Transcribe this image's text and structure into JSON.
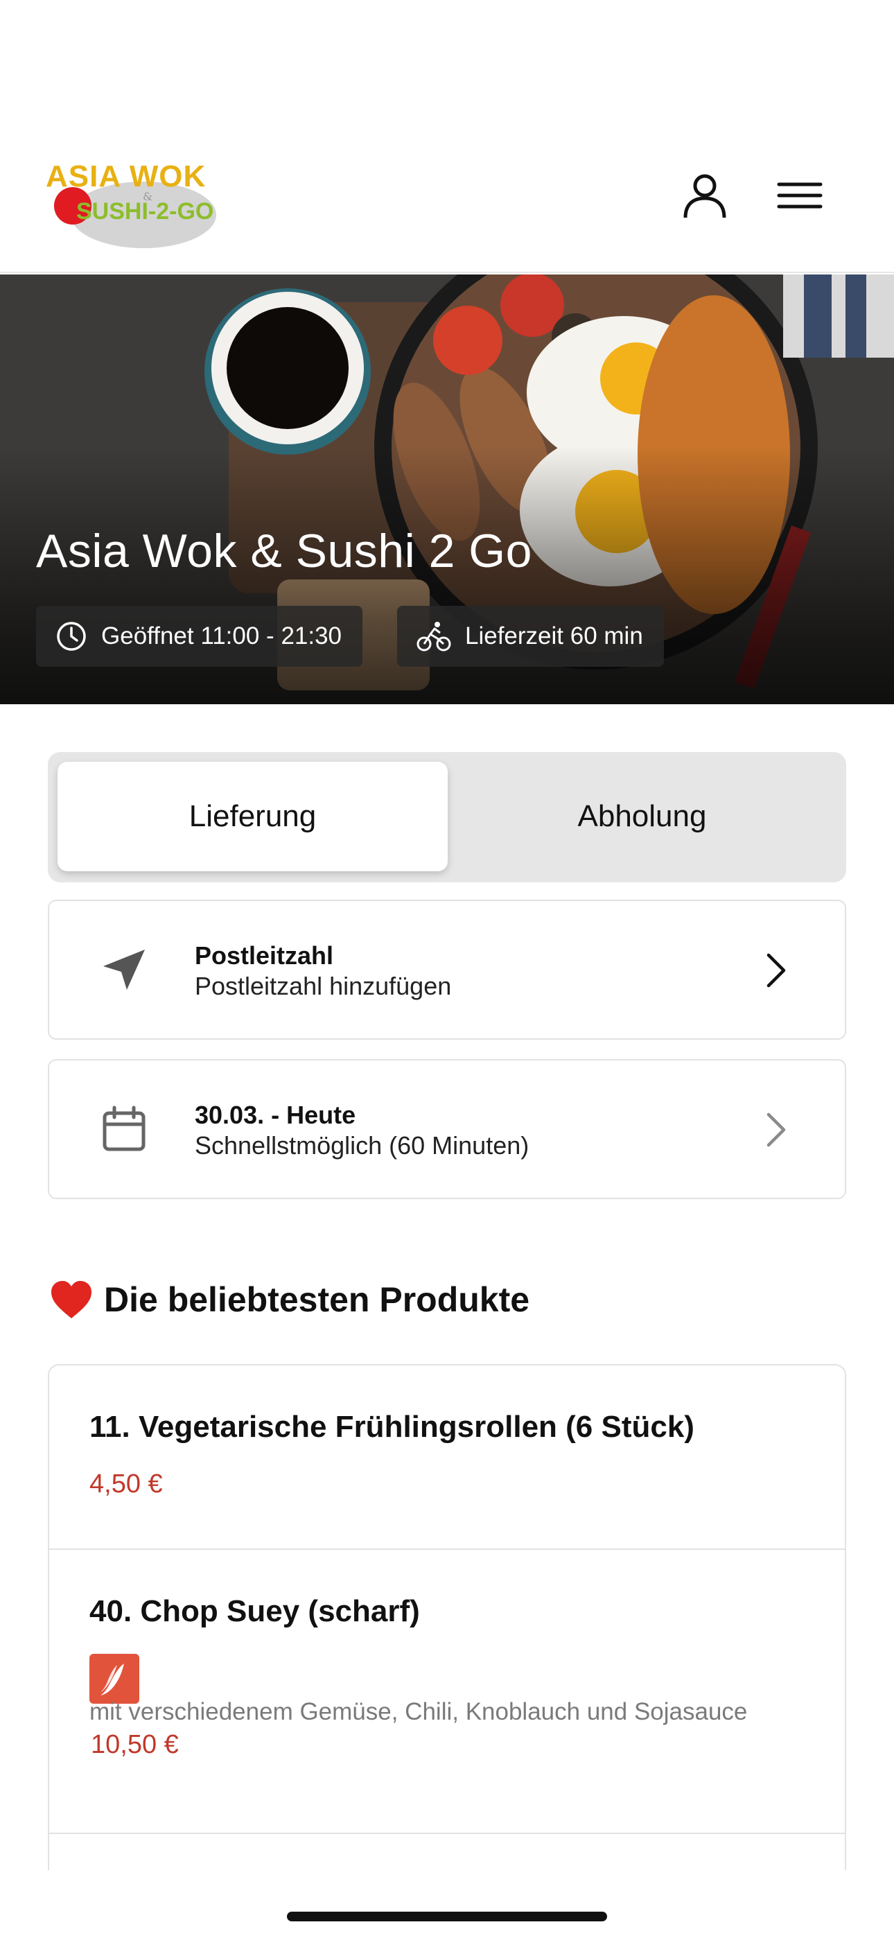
{
  "header": {
    "logo": {
      "line1": "ASIA WOK",
      "amp": "&",
      "line2": "SUSHI-2-GO"
    },
    "user_icon": "user-icon",
    "menu_icon": "menu-icon"
  },
  "hero": {
    "title": "Asia Wok & Sushi 2 Go",
    "opening": "Geöffnet 11:00 - 21:30",
    "delivery_time": "Lieferzeit 60 min"
  },
  "mode_toggle": {
    "options": [
      "Lieferung",
      "Abholung"
    ],
    "selected": "Lieferung"
  },
  "postcode_card": {
    "title": "Postleitzahl",
    "subtitle": "Postleitzahl hinzufügen",
    "icon": "location-arrow-icon"
  },
  "date_card": {
    "title": "30.03. - Heute",
    "subtitle": "Schnellstmöglich (60 Minuten)",
    "icon": "calendar-icon"
  },
  "popular": {
    "title": "Die beliebtesten Produkte",
    "products": [
      {
        "name": "11. Vegetarische Frühlingsrollen (6 Stück)",
        "price": "4,50 €"
      },
      {
        "name": "40. Chop Suey (scharf)",
        "description": "mit verschiedenem Gemüse, Chili, Knoblauch und Sojasauce",
        "price": "10,50 €",
        "badge": "chili-icon"
      }
    ]
  },
  "colors": {
    "price": "#c0392b",
    "chili_badge": "#e2533b",
    "logo_yellow": "#e8b012",
    "logo_green": "#8dbd2b"
  }
}
